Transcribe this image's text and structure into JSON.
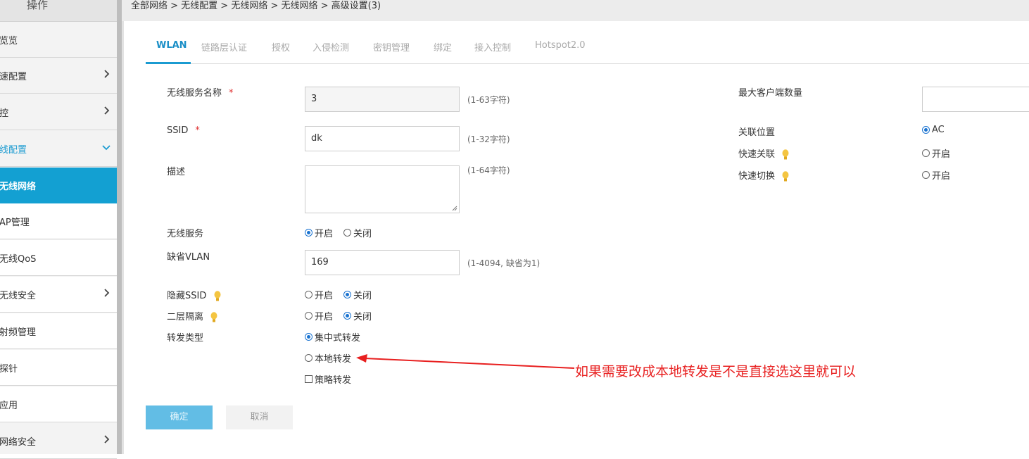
{
  "sidebar": {
    "header": "操作",
    "items": [
      {
        "label": "览览",
        "chevron": false
      },
      {
        "label": "速配置",
        "chevron": true
      },
      {
        "label": "控",
        "chevron": true
      },
      {
        "label": "线配置",
        "chevron": "down"
      },
      {
        "label": "无线网络",
        "active": true
      },
      {
        "label": "AP管理"
      },
      {
        "label": "无线QoS"
      },
      {
        "label": "无线安全",
        "chevron": true
      },
      {
        "label": "射频管理"
      },
      {
        "label": "探针"
      },
      {
        "label": "应用"
      },
      {
        "label": "网络安全",
        "chevron": true
      }
    ]
  },
  "breadcrumb": "全部网络 > 无线配置 > 无线网络 > 无线网络 > 高级设置(3)",
  "tabs": [
    "WLAN",
    "链路层认证",
    "授权",
    "入侵检测",
    "密钥管理",
    "绑定",
    "接入控制",
    "Hotspot2.0"
  ],
  "form": {
    "service_name": {
      "label": "无线服务名称",
      "required": "*",
      "value": "3",
      "hint": "(1-63字符)"
    },
    "ssid": {
      "label": "SSID",
      "required": "*",
      "value": "dk",
      "hint": "(1-32字符)"
    },
    "description": {
      "label": "描述",
      "value": "",
      "hint": "(1-64字符)"
    },
    "wireless_service": {
      "label": "无线服务",
      "on": "开启",
      "off": "关闭",
      "selected": "on"
    },
    "default_vlan": {
      "label": "缺省VLAN",
      "value": "169",
      "hint": "(1-4094, 缺省为1)"
    },
    "hide_ssid": {
      "label": "隐藏SSID",
      "on": "开启",
      "off": "关闭",
      "selected": "off"
    },
    "l2_isolation": {
      "label": "二层隔离",
      "on": "开启",
      "off": "关闭",
      "selected": "off"
    },
    "forward_type": {
      "label": "转发类型",
      "central": "集中式转发",
      "local": "本地转发",
      "policy": "策略转发",
      "selected": "central"
    }
  },
  "right": {
    "max_clients": {
      "label": "最大客户端数量",
      "value": ""
    },
    "assoc_location": {
      "label": "关联位置",
      "value": "AC"
    },
    "fast_assoc": {
      "label": "快速关联",
      "value": "开启"
    },
    "fast_handoff": {
      "label": "快速切换",
      "value": "开启"
    }
  },
  "buttons": {
    "ok": "确定",
    "cancel": "取消"
  },
  "annotation": "如果需要改成本地转发是不是直接选这里就可以",
  "colors": {
    "accent": "#13a0d2",
    "annotation": "#e82020",
    "bulb": "#f4c542"
  }
}
